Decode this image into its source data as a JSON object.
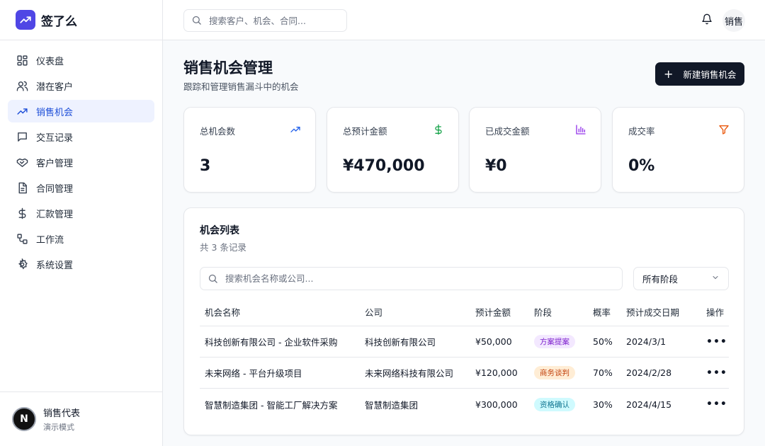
{
  "app": {
    "name": "签了么"
  },
  "sidebar": {
    "items": [
      {
        "label": "仪表盘",
        "icon": "dashboard-icon"
      },
      {
        "label": "潜在客户",
        "icon": "users-icon"
      },
      {
        "label": "销售机会",
        "icon": "trending-up-icon",
        "active": true
      },
      {
        "label": "交互记录",
        "icon": "message-icon"
      },
      {
        "label": "客户管理",
        "icon": "handshake-icon"
      },
      {
        "label": "合同管理",
        "icon": "document-icon"
      },
      {
        "label": "汇款管理",
        "icon": "dollar-icon"
      },
      {
        "label": "工作流",
        "icon": "workflow-icon"
      },
      {
        "label": "系统设置",
        "icon": "gear-icon"
      }
    ],
    "user": {
      "avatar_letter": "N",
      "name": "销售代表",
      "role": "演示模式"
    }
  },
  "topbar": {
    "search_placeholder": "搜索客户、机会、合同...",
    "user_label": "销售"
  },
  "page": {
    "title": "销售机会管理",
    "subtitle": "跟踪和管理销售漏斗中的机会",
    "new_button": "新建销售机会"
  },
  "stats": [
    {
      "label": "总机会数",
      "value": "3",
      "icon": "trending-up-icon",
      "color": "#2563eb"
    },
    {
      "label": "总预计金额",
      "value": "¥470,000",
      "icon": "dollar-icon",
      "color": "#16a34a"
    },
    {
      "label": "已成交金额",
      "value": "¥0",
      "icon": "bar-chart-icon",
      "color": "#9333ea"
    },
    {
      "label": "成交率",
      "value": "0%",
      "icon": "filter-icon",
      "color": "#ea580c"
    }
  ],
  "list": {
    "title": "机会列表",
    "count": "共 3 条记录",
    "search_placeholder": "搜索机会名称或公司...",
    "stage_filter": "所有阶段",
    "columns": [
      "机会名称",
      "公司",
      "预计金额",
      "阶段",
      "概率",
      "预计成交日期",
      "操作"
    ],
    "rows": [
      {
        "name": "科技创新有限公司 - 企业软件采购",
        "company": "科技创新有限公司",
        "amount": "¥50,000",
        "stage": "方案提案",
        "stage_color": "purple",
        "probability": "50%",
        "date": "2024/3/1",
        "action": "•••"
      },
      {
        "name": "未来网络 - 平台升级项目",
        "company": "未来网络科技有限公司",
        "amount": "¥120,000",
        "stage": "商务谈判",
        "stage_color": "orange",
        "probability": "70%",
        "date": "2024/2/28",
        "action": "•••"
      },
      {
        "name": "智慧制造集团 - 智能工厂解决方案",
        "company": "智慧制造集团",
        "amount": "¥300,000",
        "stage": "资格确认",
        "stage_color": "cyan",
        "probability": "30%",
        "date": "2024/4/15",
        "action": "•••"
      }
    ]
  },
  "colors": {
    "brand": "#4f46e5",
    "active_nav_bg": "#eef2ff",
    "active_nav_text": "#1d4ed8",
    "primary_button": "#111827"
  }
}
